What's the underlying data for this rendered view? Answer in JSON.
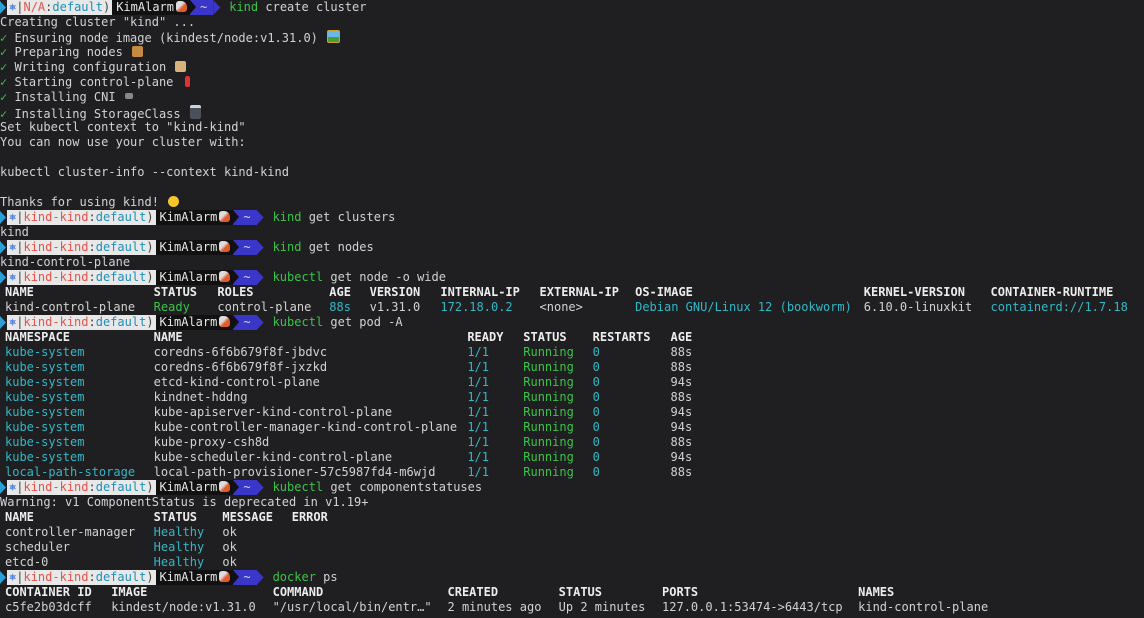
{
  "prompt": {
    "k8s_symbol": "⎈",
    "separator": "|",
    "user": "KimAlarm",
    "dir": "~"
  },
  "blocks": [
    {
      "prompt": {
        "cluster": "N/A",
        "namespace": "default"
      },
      "command": {
        "cmd": "kind",
        "args": " create cluster"
      },
      "output": [
        {
          "text": "Creating cluster \"kind\" ..."
        },
        {
          "check": "✓",
          "text": " Ensuring node image (kindest/node:v1.31.0)",
          "emoji": "picture-icon"
        },
        {
          "check": "✓",
          "text": " Preparing nodes",
          "emoji": "package-icon"
        },
        {
          "check": "✓",
          "text": " Writing configuration",
          "emoji": "scroll-icon"
        },
        {
          "check": "✓",
          "text": " Starting control-plane",
          "emoji": "joystick-icon"
        },
        {
          "check": "✓",
          "text": " Installing CNI",
          "emoji": "plug-icon"
        },
        {
          "check": "✓",
          "text": " Installing StorageClass",
          "emoji": "floppy-disk-icon"
        },
        {
          "text": "Set kubectl context to \"kind-kind\""
        },
        {
          "text": "You can now use your cluster with:"
        },
        {
          "text": ""
        },
        {
          "text": "kubectl cluster-info --context kind-kind"
        },
        {
          "text": ""
        },
        {
          "text": "Thanks for using kind!",
          "emoji": "smile-icon"
        }
      ]
    },
    {
      "prompt": {
        "cluster": "kind-kind",
        "namespace": "default"
      },
      "command": {
        "cmd": "kind",
        "args": " get clusters"
      },
      "output": [
        {
          "text": "kind"
        }
      ]
    },
    {
      "prompt": {
        "cluster": "kind-kind",
        "namespace": "default"
      },
      "command": {
        "cmd": "kind",
        "args": " get nodes"
      },
      "output": [
        {
          "text": "kind-control-plane"
        }
      ]
    }
  ],
  "nodes_cmd": {
    "prompt": {
      "cluster": "kind-kind",
      "namespace": "default"
    },
    "cmd": "kubectl",
    "args": " get node -o wide"
  },
  "nodes_table": {
    "headers": [
      "NAME",
      "STATUS",
      "ROLES",
      "AGE",
      "VERSION",
      "INTERNAL-IP",
      "EXTERNAL-IP",
      "OS-IMAGE",
      "KERNEL-VERSION",
      "CONTAINER-RUNTIME"
    ],
    "rows": [
      [
        "kind-control-plane",
        "Ready",
        "control-plane",
        "88s",
        "v1.31.0",
        "172.18.0.2",
        "<none>",
        "Debian GNU/Linux 12 (bookworm)",
        "6.10.0-linuxkit",
        "containerd://1.7.18"
      ]
    ]
  },
  "pods_cmd": {
    "prompt": {
      "cluster": "kind-kind",
      "namespace": "default"
    },
    "cmd": "kubectl",
    "args": " get pod -A"
  },
  "pods_table": {
    "headers": [
      "NAMESPACE",
      "NAME",
      "READY",
      "STATUS",
      "RESTARTS",
      "AGE"
    ],
    "rows": [
      [
        "kube-system",
        "coredns-6f6b679f8f-jbdvc",
        "1/1",
        "Running",
        "0",
        "88s"
      ],
      [
        "kube-system",
        "coredns-6f6b679f8f-jxzkd",
        "1/1",
        "Running",
        "0",
        "88s"
      ],
      [
        "kube-system",
        "etcd-kind-control-plane",
        "1/1",
        "Running",
        "0",
        "94s"
      ],
      [
        "kube-system",
        "kindnet-hddng",
        "1/1",
        "Running",
        "0",
        "88s"
      ],
      [
        "kube-system",
        "kube-apiserver-kind-control-plane",
        "1/1",
        "Running",
        "0",
        "94s"
      ],
      [
        "kube-system",
        "kube-controller-manager-kind-control-plane",
        "1/1",
        "Running",
        "0",
        "94s"
      ],
      [
        "kube-system",
        "kube-proxy-csh8d",
        "1/1",
        "Running",
        "0",
        "88s"
      ],
      [
        "kube-system",
        "kube-scheduler-kind-control-plane",
        "1/1",
        "Running",
        "0",
        "94s"
      ],
      [
        "local-path-storage",
        "local-path-provisioner-57c5987fd4-m6wjd",
        "1/1",
        "Running",
        "0",
        "88s"
      ]
    ]
  },
  "cs_cmd": {
    "prompt": {
      "cluster": "kind-kind",
      "namespace": "default"
    },
    "cmd": "kubectl",
    "args": " get componentstatuses"
  },
  "cs_warning": "Warning: v1 ComponentStatus is deprecated in v1.19+",
  "cs_table": {
    "headers": [
      "NAME",
      "STATUS",
      "MESSAGE",
      "ERROR"
    ],
    "rows": [
      [
        "controller-manager",
        "Healthy",
        "ok",
        ""
      ],
      [
        "scheduler",
        "Healthy",
        "ok",
        ""
      ],
      [
        "etcd-0",
        "Healthy",
        "ok",
        ""
      ]
    ]
  },
  "docker_cmd": {
    "prompt": {
      "cluster": "kind-kind",
      "namespace": "default"
    },
    "cmd": "docker",
    "args": " ps"
  },
  "docker_table": {
    "headers": [
      "CONTAINER ID",
      "IMAGE",
      "COMMAND",
      "CREATED",
      "STATUS",
      "PORTS",
      "NAMES"
    ],
    "rows": [
      [
        "c5fe2b03dcff",
        "kindest/node:v1.31.0",
        "\"/usr/local/bin/entr…\"",
        "2 minutes ago",
        "Up 2 minutes",
        "127.0.0.1:53474->6443/tcp",
        "kind-control-plane"
      ]
    ]
  },
  "colors": {
    "background": "#1f1f21",
    "green": "#3cc24a",
    "cyan": "#33b7c6",
    "prompt_dir": "#3a36c8"
  }
}
